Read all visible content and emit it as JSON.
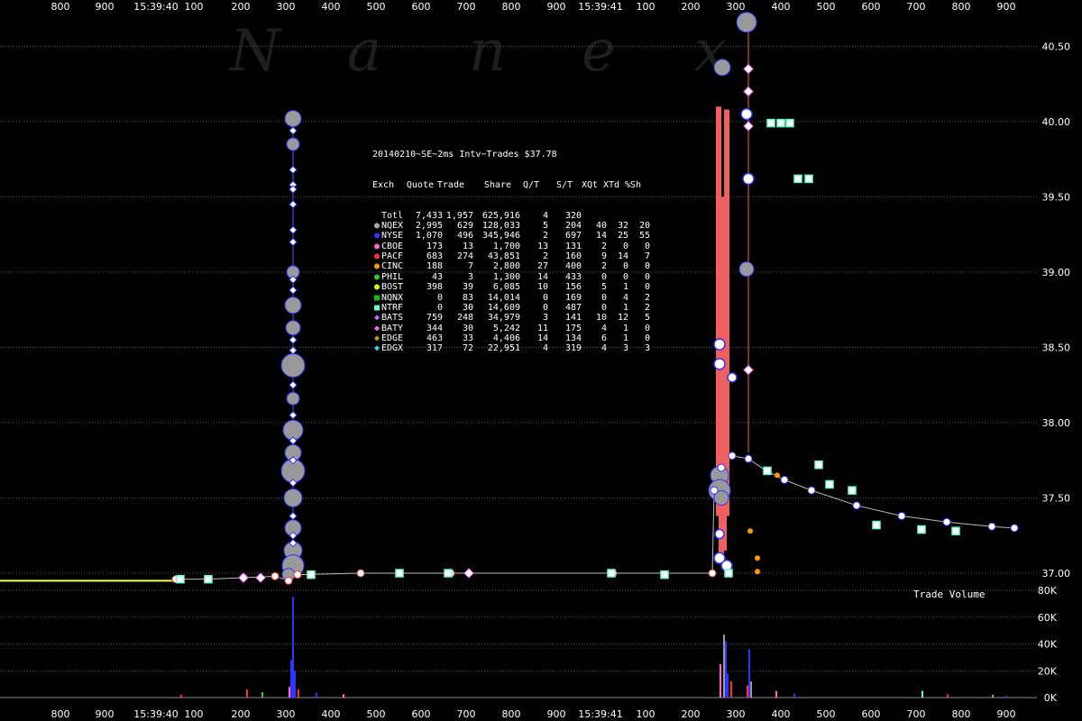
{
  "chart_data": {
    "type": "scatter",
    "watermark": [
      "N",
      "a",
      "n",
      "e",
      "x"
    ],
    "x_tick_labels": [
      "800",
      "900",
      "15:39:40",
      "100",
      "200",
      "300",
      "400",
      "500",
      "600",
      "700",
      "800",
      "900",
      "15:39:41",
      "100",
      "200",
      "300",
      "400",
      "500",
      "600",
      "700",
      "800",
      "900"
    ],
    "price_axis": {
      "ticks": [
        "40.50",
        "40.00",
        "39.50",
        "39.00",
        "38.50",
        "38.00",
        "37.50",
        "37.00"
      ],
      "ylim": [
        36.94,
        40.7
      ]
    },
    "volume_axis": {
      "label": "Trade Volume",
      "ticks": [
        "80K",
        "60K",
        "40K",
        "20K",
        "0K"
      ],
      "ylim": [
        0,
        80000
      ]
    },
    "colors": {
      "background": "#000000",
      "grid": "#555555",
      "nyse": "#3333ff",
      "nqex": "#999999",
      "quote_band": "#f06060",
      "ntrf": "#66ffcc",
      "prior": "#ffff33"
    },
    "table": {
      "title": "20140210~SE~2ms Intv~Trades $37.78",
      "headers": [
        "Exch",
        "Quote",
        "Trade",
        "Share",
        "Q/T",
        "S/T",
        "XQt",
        "XTd",
        "%Sh"
      ],
      "rows": [
        {
          "symbol": "",
          "color": "",
          "name": "Totl",
          "quote": "7,433",
          "trade": "1,957",
          "share": "625,916",
          "qt": "4",
          "st": "320",
          "xqt": "",
          "xtd": "",
          "sh": ""
        },
        {
          "symbol": "circle",
          "color": "#aaaaaa",
          "name": "NQEX",
          "quote": "2,995",
          "trade": "629",
          "share": "128,033",
          "qt": "5",
          "st": "204",
          "xqt": "40",
          "xtd": "32",
          "sh": "20"
        },
        {
          "symbol": "circle",
          "color": "#3333ff",
          "name": "NYSE",
          "quote": "1,070",
          "trade": "496",
          "share": "345,946",
          "qt": "2",
          "st": "697",
          "xqt": "14",
          "xtd": "25",
          "sh": "55"
        },
        {
          "symbol": "circle",
          "color": "#ff66cc",
          "name": "CBOE",
          "quote": "173",
          "trade": "13",
          "share": "1,700",
          "qt": "13",
          "st": "131",
          "xqt": "2",
          "xtd": "0",
          "sh": "0"
        },
        {
          "symbol": "circle",
          "color": "#ff3333",
          "name": "PACF",
          "quote": "683",
          "trade": "274",
          "share": "43,851",
          "qt": "2",
          "st": "160",
          "xqt": "9",
          "xtd": "14",
          "sh": "7"
        },
        {
          "symbol": "circle",
          "color": "#ff9900",
          "name": "CINC",
          "quote": "188",
          "trade": "7",
          "share": "2,800",
          "qt": "27",
          "st": "400",
          "xqt": "2",
          "xtd": "0",
          "sh": "0"
        },
        {
          "symbol": "circle",
          "color": "#33cc33",
          "name": "PHIL",
          "quote": "43",
          "trade": "3",
          "share": "1,300",
          "qt": "14",
          "st": "433",
          "xqt": "0",
          "xtd": "0",
          "sh": "0"
        },
        {
          "symbol": "circle",
          "color": "#ccff00",
          "name": "BOST",
          "quote": "398",
          "trade": "39",
          "share": "6,085",
          "qt": "10",
          "st": "156",
          "xqt": "5",
          "xtd": "1",
          "sh": "0"
        },
        {
          "symbol": "square",
          "color": "#00cc00",
          "name": "NQNX",
          "quote": "0",
          "trade": "83",
          "share": "14,014",
          "qt": "0",
          "st": "169",
          "xqt": "0",
          "xtd": "4",
          "sh": "2"
        },
        {
          "symbol": "square",
          "color": "#66ffcc",
          "name": "NTRF",
          "quote": "0",
          "trade": "30",
          "share": "14,609",
          "qt": "0",
          "st": "487",
          "xqt": "0",
          "xtd": "1",
          "sh": "2"
        },
        {
          "symbol": "diamond",
          "color": "#cc66ff",
          "name": "BATS",
          "quote": "759",
          "trade": "248",
          "share": "34,979",
          "qt": "3",
          "st": "141",
          "xqt": "10",
          "xtd": "12",
          "sh": "5"
        },
        {
          "symbol": "diamond",
          "color": "#ff66ff",
          "name": "BATY",
          "quote": "344",
          "trade": "30",
          "share": "5,242",
          "qt": "11",
          "st": "175",
          "xqt": "4",
          "xtd": "1",
          "sh": "0"
        },
        {
          "symbol": "diamond",
          "color": "#cc9900",
          "name": "EDGE",
          "quote": "463",
          "trade": "33",
          "share": "4,406",
          "qt": "14",
          "st": "134",
          "xqt": "6",
          "xtd": "1",
          "sh": "0"
        },
        {
          "symbol": "diamond",
          "color": "#33ccff",
          "name": "EDGX",
          "quote": "317",
          "trade": "72",
          "share": "22,951",
          "qt": "4",
          "st": "319",
          "xqt": "4",
          "xtd": "3",
          "sh": "3"
        }
      ]
    },
    "series": [
      {
        "kind": "prior_price",
        "color": "#ffff33",
        "points": [
          [
            0,
            36.95
          ],
          [
            195,
            36.95
          ]
        ]
      },
      {
        "kind": "trades_path",
        "points": [
          [
            195,
            36.96
          ],
          [
            230,
            36.96
          ],
          [
            270,
            36.97
          ],
          [
            305,
            36.98
          ],
          [
            320,
            36.95
          ],
          [
            330,
            36.99
          ],
          [
            400,
            37.0
          ],
          [
            500,
            37.0
          ],
          [
            680,
            37.0
          ],
          [
            790,
            37.0
          ],
          [
            792,
            37.55
          ],
          [
            800,
            37.7
          ],
          [
            812,
            37.78
          ],
          [
            830,
            37.76
          ],
          [
            850,
            37.68
          ],
          [
            870,
            37.62
          ],
          [
            900,
            37.55
          ],
          [
            950,
            37.45
          ],
          [
            1000,
            37.38
          ],
          [
            1050,
            37.34
          ],
          [
            1100,
            37.31
          ],
          [
            1125,
            37.3
          ]
        ]
      },
      {
        "kind": "nqex_spike_1",
        "color": "#999999",
        "points": [
          [
            325,
            40.02,
            9
          ],
          [
            325,
            39.85,
            7
          ],
          [
            325,
            39.0,
            7
          ],
          [
            325,
            38.78,
            9
          ],
          [
            325,
            38.63,
            8
          ],
          [
            325,
            38.38,
            13
          ],
          [
            325,
            38.16,
            7
          ],
          [
            325,
            37.95,
            11
          ],
          [
            325,
            37.8,
            9
          ],
          [
            325,
            37.68,
            13
          ],
          [
            325,
            37.5,
            10
          ],
          [
            325,
            37.3,
            9
          ],
          [
            325,
            37.15,
            10
          ],
          [
            325,
            37.05,
            12
          ],
          [
            320,
            36.99,
            7
          ]
        ]
      },
      {
        "kind": "spike_1_small",
        "color": "#ffffff",
        "points": [
          [
            325,
            39.94
          ],
          [
            325,
            39.68
          ],
          [
            325,
            39.58
          ],
          [
            325,
            39.55
          ],
          [
            325,
            39.45
          ],
          [
            325,
            39.28
          ],
          [
            325,
            39.2
          ],
          [
            325,
            38.95
          ],
          [
            325,
            38.88
          ],
          [
            325,
            38.55
          ],
          [
            325,
            38.48
          ],
          [
            325,
            38.25
          ],
          [
            325,
            38.05
          ],
          [
            325,
            37.88
          ],
          [
            325,
            37.75
          ],
          [
            325,
            37.6
          ],
          [
            325,
            37.38
          ],
          [
            325,
            37.25
          ],
          [
            325,
            37.2
          ]
        ]
      },
      {
        "kind": "quote_band",
        "color": "#f06060",
        "bars": [
          [
            797,
            40.1,
            37.38
          ],
          [
            806,
            40.08,
            37.38
          ],
          [
            800,
            39.5,
            37.1
          ],
          [
            803,
            39.48,
            37.15
          ]
        ]
      },
      {
        "kind": "nqex_spike_2",
        "color": "#999999",
        "points": [
          [
            828,
            40.66,
            11
          ],
          [
            801,
            40.36,
            9
          ],
          [
            828,
            39.02,
            8
          ],
          [
            798,
            37.65,
            10
          ],
          [
            798,
            37.55,
            12
          ],
          [
            800,
            37.5,
            8
          ]
        ]
      },
      {
        "kind": "spike_2_circles",
        "color": "#ffffff",
        "points": [
          [
            828,
            40.05,
            6
          ],
          [
            830,
            39.62,
            6
          ],
          [
            798,
            38.52,
            6
          ],
          [
            798,
            38.39,
            6
          ],
          [
            812,
            38.3,
            5
          ],
          [
            798,
            37.26,
            5
          ],
          [
            798,
            37.1,
            6
          ],
          [
            806,
            37.05,
            6
          ]
        ]
      },
      {
        "kind": "ntrf_squares",
        "color": "#66ffcc",
        "points": [
          [
            855,
            39.99
          ],
          [
            866,
            39.99
          ],
          [
            876,
            39.99
          ],
          [
            885,
            39.62
          ],
          [
            897,
            39.62
          ],
          [
            908,
            37.72
          ],
          [
            920,
            37.59
          ],
          [
            945,
            37.55
          ],
          [
            972,
            37.32
          ],
          [
            1022,
            37.29
          ],
          [
            1060,
            37.28
          ],
          [
            851,
            37.68
          ],
          [
            808,
            37.0
          ],
          [
            678,
            37.0
          ],
          [
            737,
            36.99
          ],
          [
            497,
            37.0
          ],
          [
            443,
            37.0
          ],
          [
            345,
            36.99
          ],
          [
            231,
            36.96
          ],
          [
            200,
            36.96
          ]
        ]
      },
      {
        "kind": "bats_diamonds",
        "color": "#ff66ff",
        "points": [
          [
            830,
            38.35
          ],
          [
            520,
            37.0
          ],
          [
            270,
            36.97
          ],
          [
            289,
            36.97
          ],
          [
            830,
            39.97
          ],
          [
            830,
            40.2
          ],
          [
            830,
            40.35
          ]
        ]
      },
      {
        "kind": "edge_marks",
        "color": "#ff9900",
        "points": [
          [
            840,
            37.01
          ],
          [
            840,
            37.1
          ],
          [
            832,
            37.28
          ],
          [
            862,
            37.65
          ]
        ]
      },
      {
        "kind": "volume",
        "bars": [
          [
            324,
            75000,
            "#3333ff"
          ],
          [
            322,
            28000,
            "#3333ff"
          ],
          [
            326,
            20000,
            "#3333ff"
          ],
          [
            320,
            8000,
            "#ff66cc"
          ],
          [
            330,
            6000,
            "#ff3333"
          ],
          [
            802,
            47000,
            "#999999"
          ],
          [
            804,
            42000,
            "#3333ff"
          ],
          [
            798,
            25000,
            "#ff66cc"
          ],
          [
            806,
            18000,
            "#3333ff"
          ],
          [
            810,
            12000,
            "#ff3333"
          ],
          [
            830,
            36000,
            "#3333ff"
          ],
          [
            832,
            12000,
            "#999999"
          ],
          [
            828,
            9000,
            "#ff3333"
          ],
          [
            273,
            6000,
            "#ff3333"
          ],
          [
            290,
            4000,
            "#33cc33"
          ],
          [
            350,
            3500,
            "#3333ff"
          ],
          [
            380,
            2500,
            "#ff66cc"
          ],
          [
            200,
            2000,
            "#ff3333"
          ],
          [
            860,
            5000,
            "#ff66cc"
          ],
          [
            880,
            3000,
            "#3333ff"
          ],
          [
            1022,
            5000,
            "#66ffcc"
          ],
          [
            1050,
            2500,
            "#ff3333"
          ],
          [
            1100,
            2000,
            "#ff66cc"
          ],
          [
            1115,
            1500,
            "#3333ff"
          ]
        ]
      }
    ]
  }
}
